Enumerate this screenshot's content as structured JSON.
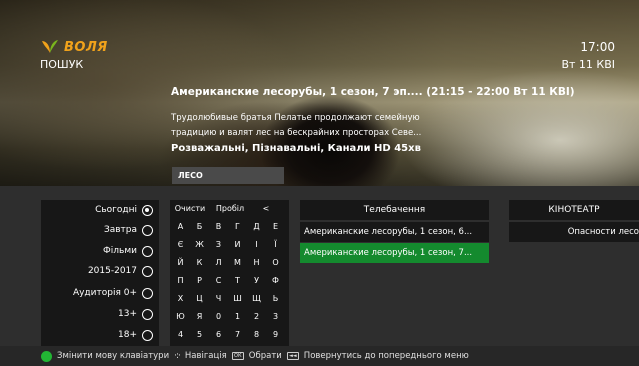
{
  "header": {
    "logo_text": "ВОЛЯ",
    "section": "ПОШУК",
    "time": "17:00",
    "date": "Вт 11 КВІ"
  },
  "program": {
    "title": "Американские лесорубы, 1 сезон, 7 эп.... (21:15 - 22:00 Вт 11 КВІ)",
    "description": "Трудолюбивые братья Пелатье продолжают семейную традицию и валят лес на бескрайних просторах Севе...",
    "meta": "Розважальні, Пізнавальні, Канали HD  45хв"
  },
  "search": {
    "query": "ЛЕСО"
  },
  "filters": [
    {
      "label": "Сьогодні",
      "selected": true
    },
    {
      "label": "Завтра",
      "selected": false
    },
    {
      "label": "Фільми",
      "selected": false
    },
    {
      "label": "2015-2017",
      "selected": false
    },
    {
      "label": "Аудиторія 0+",
      "selected": false
    },
    {
      "label": "13+",
      "selected": false
    },
    {
      "label": "18+",
      "selected": false
    }
  ],
  "keyboard": {
    "clear": "Очисти",
    "space": "Пробіл",
    "back": "<",
    "keys": [
      [
        "А",
        "Б",
        "В",
        "Г",
        "Д",
        "Е"
      ],
      [
        "Є",
        "Ж",
        "З",
        "И",
        "І",
        "Ї"
      ],
      [
        "Й",
        "К",
        "Л",
        "М",
        "Н",
        "О"
      ],
      [
        "П",
        "Р",
        "С",
        "Т",
        "У",
        "Ф"
      ],
      [
        "Х",
        "Ц",
        "Ч",
        "Ш",
        "Щ",
        "Ь"
      ],
      [
        "Ю",
        "Я",
        "0",
        "1",
        "2",
        "3"
      ],
      [
        "4",
        "5",
        "6",
        "7",
        "8",
        "9"
      ]
    ]
  },
  "results": {
    "tv_header": "Телебачення",
    "tv_items": [
      "Американские лесорубы, 1 сезон, 6...",
      "Американские лесорубы, 1 сезон, 7..."
    ],
    "cinema_header": "КІНОТЕАТР",
    "cinema_items": [
      "Опасности лесо"
    ]
  },
  "footer": {
    "change_lang": "Змінити мову клавіатури",
    "navigation": "Навігація",
    "select": "Обрати",
    "back": "Повернутись до попереднього меню",
    "ok_key": "ОК",
    "back_key": "◄◄"
  },
  "colors": {
    "accent_green": "#148a2e",
    "logo_orange": "#f0a21b"
  }
}
